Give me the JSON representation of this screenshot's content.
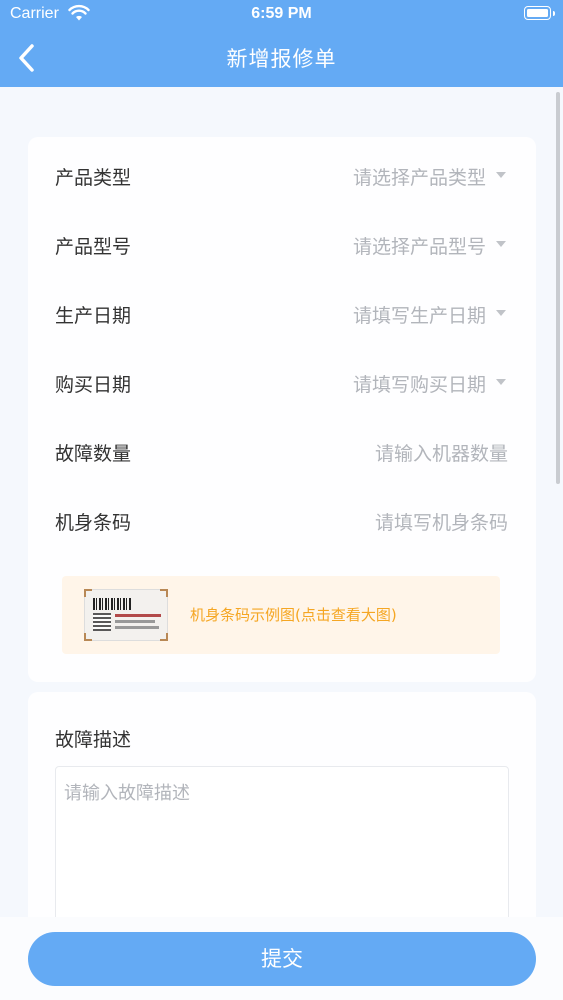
{
  "status_bar": {
    "carrier": "Carrier",
    "time": "6:59 PM"
  },
  "nav": {
    "title": "新增报修单",
    "back_icon": "chevron-left-icon"
  },
  "form": {
    "rows": [
      {
        "label": "产品类型",
        "placeholder": "请选择产品类型",
        "dropdown": true
      },
      {
        "label": "产品型号",
        "placeholder": "请选择产品型号",
        "dropdown": true
      },
      {
        "label": "生产日期",
        "placeholder": "请填写生产日期",
        "dropdown": true
      },
      {
        "label": "购买日期",
        "placeholder": "请填写购买日期",
        "dropdown": true
      },
      {
        "label": "故障数量",
        "placeholder": "请输入机器数量",
        "dropdown": false
      },
      {
        "label": "机身条码",
        "placeholder": "请填写机身条码",
        "dropdown": false
      }
    ],
    "sample_banner": {
      "text": "机身条码示例图(点击查看大图)"
    },
    "description": {
      "label": "故障描述",
      "placeholder": "请输入故障描述"
    }
  },
  "submit": {
    "label": "提交"
  },
  "colors": {
    "primary": "#64aaf4",
    "accent_orange": "#f5a623",
    "placeholder": "#b2b5bb",
    "page_bg": "#f5f8fd"
  }
}
